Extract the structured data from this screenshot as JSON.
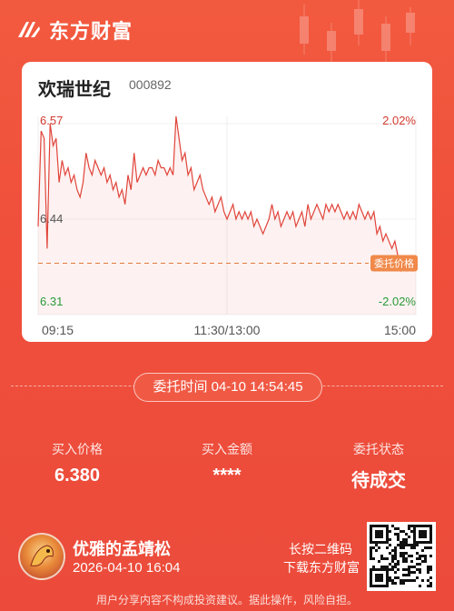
{
  "brand": {
    "name": "东方财富"
  },
  "stock": {
    "name": "欢瑞世纪",
    "code": "000892"
  },
  "chart_data": {
    "type": "line",
    "y_price_ticks": [
      "6.57",
      "6.44",
      "6.31"
    ],
    "y_pct_ticks": [
      "2.02%",
      "-2.02%"
    ],
    "x_ticks": [
      "09:15",
      "11:30/13:00",
      "15:00"
    ],
    "ylim": [
      6.31,
      6.57
    ],
    "prev_close": 6.44,
    "order_price": 6.38,
    "order_label": "委托价格",
    "series": [
      {
        "values": [
          6.43,
          6.56,
          6.55,
          6.4,
          6.57,
          6.54,
          6.55,
          6.49,
          6.52,
          6.5,
          6.51,
          6.49,
          6.5,
          6.48,
          6.47,
          6.49,
          6.53,
          6.51,
          6.5,
          6.52,
          6.51,
          6.5,
          6.51,
          6.49,
          6.5,
          6.48,
          6.49,
          6.47,
          6.48,
          6.46,
          6.5,
          6.48,
          6.53,
          6.49,
          6.5,
          6.51,
          6.5,
          6.51,
          6.51,
          6.5,
          6.52,
          6.51,
          6.51,
          6.5,
          6.51,
          6.5,
          6.58,
          6.55,
          6.52,
          6.53,
          6.5,
          6.51,
          6.48,
          6.49,
          6.5,
          6.48,
          6.47,
          6.46,
          6.47,
          6.45,
          6.46,
          6.47,
          6.45,
          6.44,
          6.45,
          6.46,
          6.44,
          6.45,
          6.44,
          6.45,
          6.44,
          6.45,
          6.43,
          6.44,
          6.43,
          6.42,
          6.43,
          6.44,
          6.46,
          6.44,
          6.45,
          6.43,
          6.44,
          6.45,
          6.44,
          6.45,
          6.43,
          6.44,
          6.45,
          6.43,
          6.46,
          6.44,
          6.45,
          6.46,
          6.45,
          6.44,
          6.46,
          6.45,
          6.46,
          6.45,
          6.46,
          6.45,
          6.44,
          6.45,
          6.44,
          6.45,
          6.44,
          6.46,
          6.45,
          6.44,
          6.45,
          6.44,
          6.45,
          6.42,
          6.43,
          6.41,
          6.42,
          6.41,
          6.4,
          6.41,
          6.39,
          6.37,
          6.38,
          6.37,
          6.38,
          6.37,
          6.38
        ]
      }
    ],
    "colors": {
      "line": "#e0443a",
      "up": "#d23b2f",
      "down": "#2a9a3a",
      "order_line": "#e27a3a",
      "order_tag_bg": "#f0894a"
    }
  },
  "order": {
    "time_label": "委托时间 04-10 14:54:45",
    "price_label": "买入价格",
    "price_value": "6.380",
    "amount_label": "买入金额",
    "amount_value": "****",
    "status_label": "委托状态",
    "status_value": "待成交"
  },
  "user": {
    "name": "优雅的孟靖松",
    "datetime": "2026-04-10 16:04"
  },
  "share": {
    "hint_line1": "长按二维码",
    "hint_line2": "下载东方财富"
  },
  "disclaimer": "用户分享内容不构成投资建议。据此操作，风险自担。",
  "icons": {
    "logo": "eastmoney-logo-icon",
    "avatar": "dragon-avatar-icon",
    "qr": "qr-code-icon"
  }
}
